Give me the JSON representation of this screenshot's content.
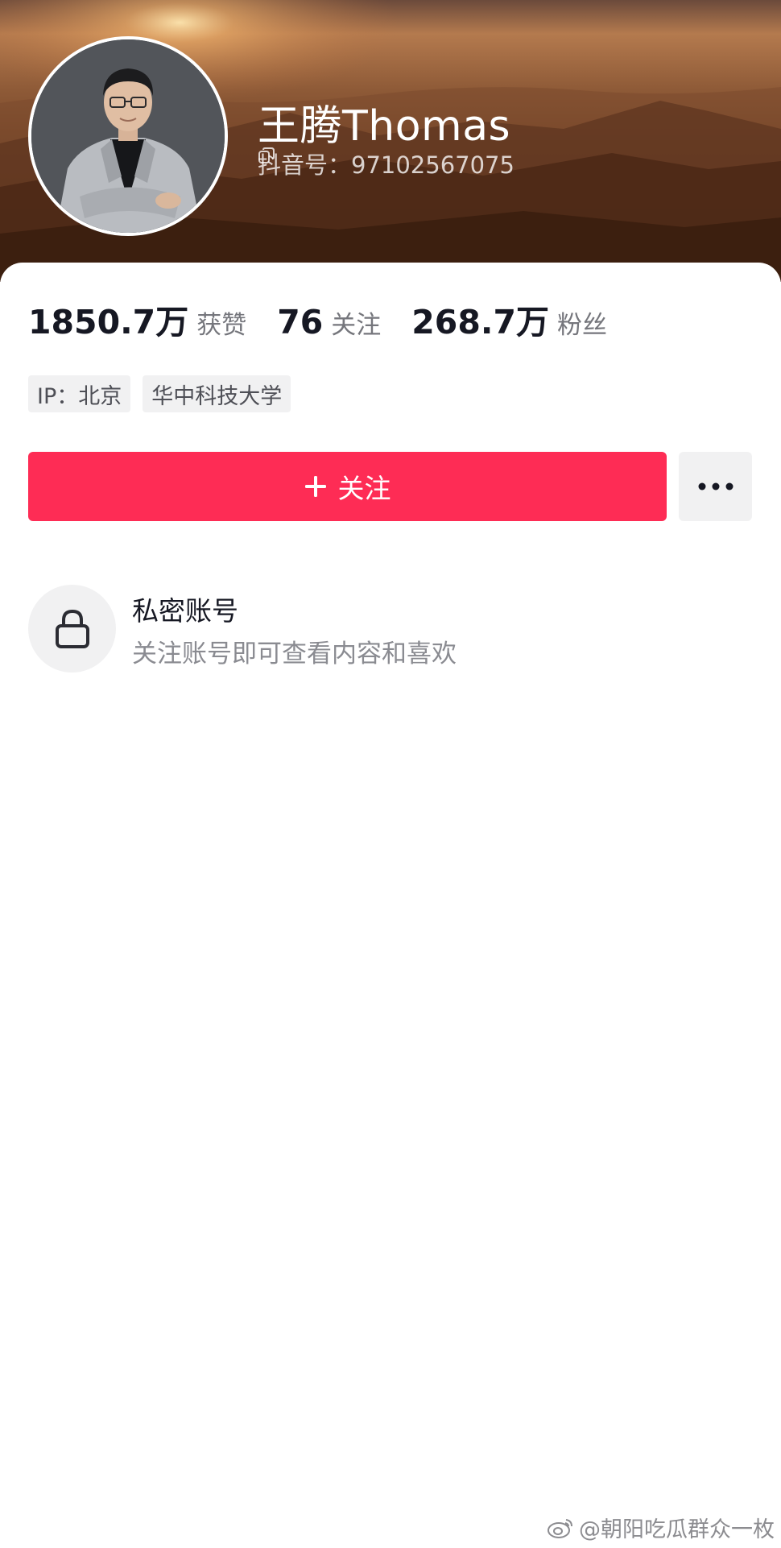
{
  "profile": {
    "name": "王腾Thomas",
    "douyin_id": "抖音号：97102567075"
  },
  "stats": [
    {
      "value": "1850.7万",
      "label": "获赞"
    },
    {
      "value": "76",
      "label": "关注"
    },
    {
      "value": "268.7万",
      "label": "粉丝"
    }
  ],
  "tags": [
    "IP：北京",
    "华中科技大学"
  ],
  "actions": {
    "follow_label": "关注",
    "more_icon": "more-icon"
  },
  "private": {
    "title": "私密账号",
    "description": "关注账号即可查看内容和喜欢"
  },
  "watermark": "@朝阳吃瓜群众一枚",
  "colors": {
    "accent": "#fe2c55",
    "text_primary": "#161823",
    "text_secondary": "#75767c",
    "chip_bg": "#f1f1f2"
  }
}
